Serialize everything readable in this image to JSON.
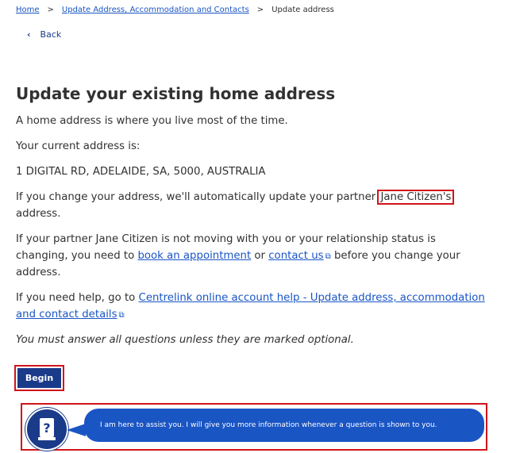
{
  "breadcrumb": {
    "home": "Home",
    "sep1": ">",
    "level2": "Update Address, Accommodation and Contacts",
    "sep2": ">",
    "current": "Update address"
  },
  "back": {
    "chevron": "‹",
    "label": "Back"
  },
  "page_title": "Update your existing home address",
  "intro": "A home address is where you live most of the time.",
  "current_address_label": "Your current address is:",
  "current_address": "1 DIGITAL RD, ADELAIDE, SA, 5000, AUSTRALIA",
  "partner_update": {
    "before": "If you change your address, we'll automatically update your partner ",
    "name": "Jane Citizen's",
    "line2": "address."
  },
  "partner_moving": {
    "line1": "If your partner Jane Citizen is not moving with you or your relationship status is",
    "line2_before": "changing, you need to ",
    "link_appointment": "book an appointment",
    "or": " or ",
    "link_contact": "contact us",
    "line2_after": " before you change your",
    "line3": "address."
  },
  "help": {
    "before": "If you need help, go to ",
    "link_line1": "Centrelink online account help - Update address, accommodation",
    "link_line2": "and contact details"
  },
  "required_note": "You must answer all questions unless they are marked optional.",
  "begin_button": "Begin",
  "assistant": {
    "icon": "question-book-icon",
    "icon_glyph": "?",
    "message": "I am here to assist you. I will give you more information whenever a question is shown to you."
  },
  "icons": {
    "external_link": "external-link-icon",
    "external_glyph": "⧉"
  },
  "colors": {
    "link": "#1a55c4",
    "primary": "#1a3a8a",
    "highlight": "#d0141a",
    "text": "#313131"
  }
}
